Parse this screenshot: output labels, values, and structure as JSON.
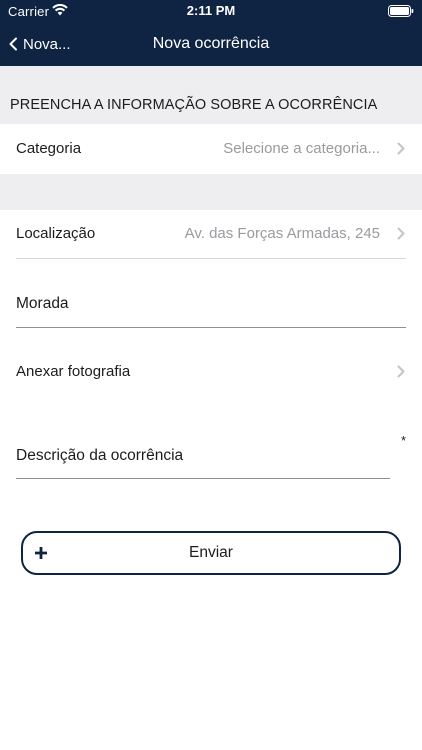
{
  "status_bar": {
    "carrier": "Carrier",
    "time": "2:11 PM",
    "wifi_icon": "wifi-icon",
    "battery_icon": "battery-icon"
  },
  "nav_bar": {
    "back_label": "Nova...",
    "back_icon": "chevron-left-icon",
    "title": "Nova ocorrência"
  },
  "form": {
    "section_header": "PREENCHA A INFORMAÇÃO SOBRE A OCORRÊNCIA",
    "category": {
      "label": "Categoria",
      "placeholder": "Selecione a categoria..."
    },
    "location": {
      "label": "Localização",
      "value": "Av. das Forças Armadas, 245"
    },
    "address": {
      "placeholder": "Morada",
      "value": ""
    },
    "photo": {
      "label": "Anexar fotografia"
    },
    "description": {
      "placeholder": "Descrição da ocorrência",
      "value": "",
      "required_mark": "*"
    },
    "submit": {
      "label": "Enviar",
      "icon": "plus-icon"
    }
  },
  "colors": {
    "nav_background": "#0f2342",
    "section_background": "#eeeef0",
    "secondary_text": "#9a9a9f",
    "accent": "#0f2342"
  }
}
